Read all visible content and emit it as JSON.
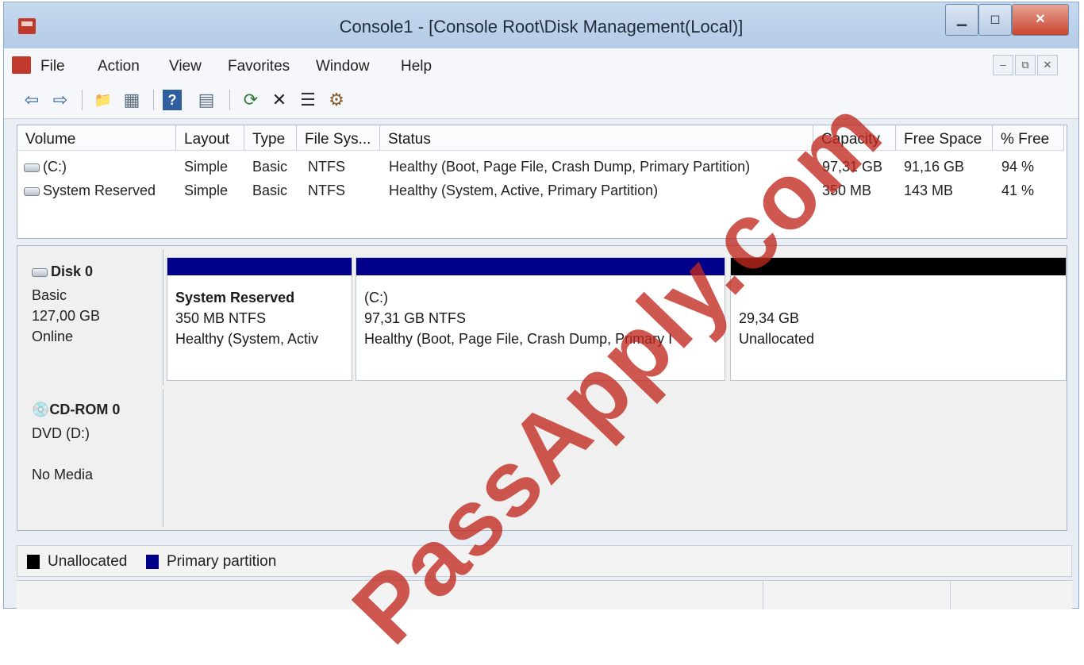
{
  "window": {
    "title": "Console1 - [Console Root\\Disk Management(Local)]",
    "controls": {
      "minimize": "▁",
      "maximize": "◻",
      "close": "✕"
    }
  },
  "menubar": {
    "items": [
      "File",
      "Action",
      "View",
      "Favorites",
      "Window",
      "Help"
    ],
    "mdi_controls": [
      "–",
      "⧉",
      "✕"
    ]
  },
  "toolbar": {
    "buttons": [
      {
        "name": "back-icon",
        "glyph": "⇦"
      },
      {
        "name": "forward-icon",
        "glyph": "⇨"
      },
      {
        "name": "up-folder-icon",
        "glyph": "📁"
      },
      {
        "name": "show-hide-tree-icon",
        "glyph": "▦"
      },
      {
        "name": "help-icon",
        "glyph": "?"
      },
      {
        "name": "properties-pane-icon",
        "glyph": "▤"
      },
      {
        "name": "refresh-icon",
        "glyph": "⟳"
      },
      {
        "name": "delete-icon",
        "glyph": "✕"
      },
      {
        "name": "properties-icon",
        "glyph": "☰"
      },
      {
        "name": "settings-icon",
        "glyph": "⚙"
      }
    ]
  },
  "volume_list": {
    "columns": [
      "Volume",
      "Layout",
      "Type",
      "File Sys...",
      "Status",
      "Capacity",
      "Free Space",
      "% Free"
    ],
    "rows": [
      [
        "(C:)",
        "Simple",
        "Basic",
        "NTFS",
        "Healthy (Boot, Page File, Crash Dump, Primary Partition)",
        "97,31 GB",
        "91,16 GB",
        "94 %"
      ],
      [
        "System Reserved",
        "Simple",
        "Basic",
        "NTFS",
        "Healthy (System, Active, Primary Partition)",
        "350 MB",
        "143 MB",
        "41 %"
      ]
    ]
  },
  "disks": [
    {
      "title": "Disk 0",
      "lines": [
        "Basic",
        "127,00 GB",
        "Online"
      ],
      "partitions": [
        {
          "name": "System Reserved",
          "size": "350 MB NTFS",
          "status": "Healthy (System, Activ",
          "color": "#00008b"
        },
        {
          "name": "(C:)",
          "size": "97,31 GB NTFS",
          "status": "Healthy (Boot, Page File, Crash Dump, Primary I",
          "color": "#00008b"
        },
        {
          "name": "",
          "size": "29,34 GB",
          "status": "Unallocated",
          "color": "#000000"
        }
      ]
    },
    {
      "title": "CD-ROM 0",
      "lines": [
        "DVD (D:)",
        "",
        "No Media"
      ]
    }
  ],
  "legend": [
    {
      "label": "Unallocated",
      "color": "#000000"
    },
    {
      "label": "Primary partition",
      "color": "#00008b"
    }
  ],
  "watermark": "PassApply.com"
}
